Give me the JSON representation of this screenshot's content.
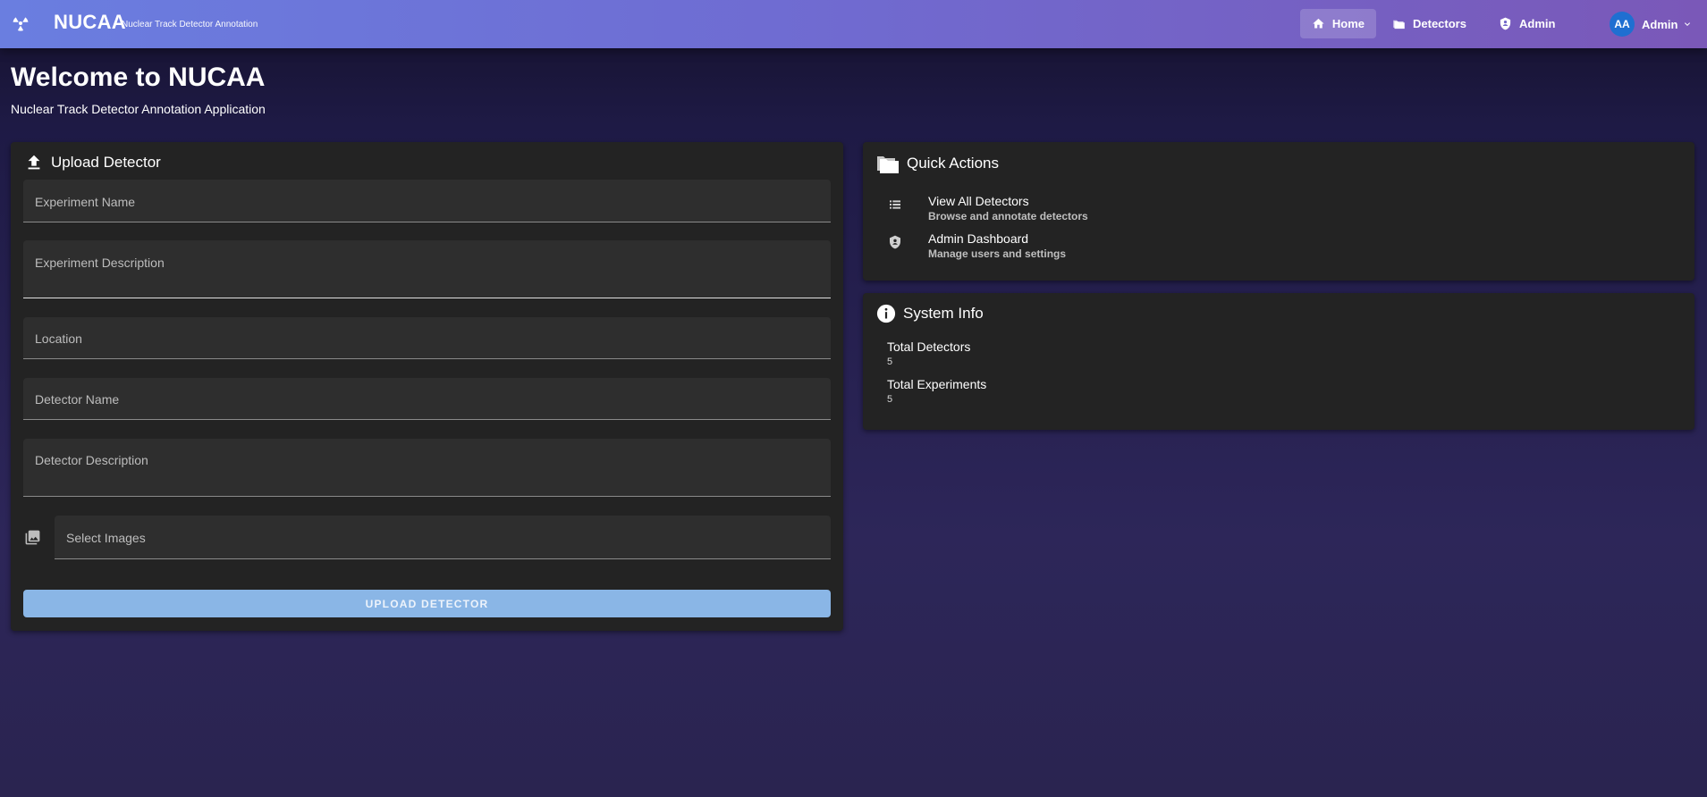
{
  "appbar": {
    "brand_title": "NUCAA",
    "brand_subtitle": "Nuclear Track Detector Annotation",
    "brand_icon": "radiation-icon",
    "nav": {
      "home": "Home",
      "detectors": "Detectors",
      "admin": "Admin"
    },
    "user": {
      "initials": "AA",
      "name": "Admin"
    }
  },
  "page": {
    "title": "Welcome to NUCAA",
    "subtitle": "Nuclear Track Detector Annotation Application"
  },
  "upload": {
    "title": "Upload Detector",
    "experiment_name": "Experiment Name",
    "experiment_description": "Experiment Description",
    "location": "Location",
    "detector_name": "Detector Name",
    "detector_description": "Detector Description",
    "select_images": "Select Images",
    "button": "UPLOAD DETECTOR"
  },
  "quick_actions": {
    "title": "Quick Actions",
    "items": [
      {
        "title": "View All Detectors",
        "subtitle": "Browse and annotate detectors",
        "icon": "list-icon"
      },
      {
        "title": "Admin Dashboard",
        "subtitle": "Manage users and settings",
        "icon": "shield-icon"
      }
    ]
  },
  "system_info": {
    "title": "System Info",
    "items": [
      {
        "label": "Total Detectors",
        "value": "5"
      },
      {
        "label": "Total Experiments",
        "value": "5"
      }
    ]
  },
  "colors": {
    "accent_button": "#8ab6e6",
    "avatar": "#1f6fd1",
    "card_bg": "#232323"
  }
}
